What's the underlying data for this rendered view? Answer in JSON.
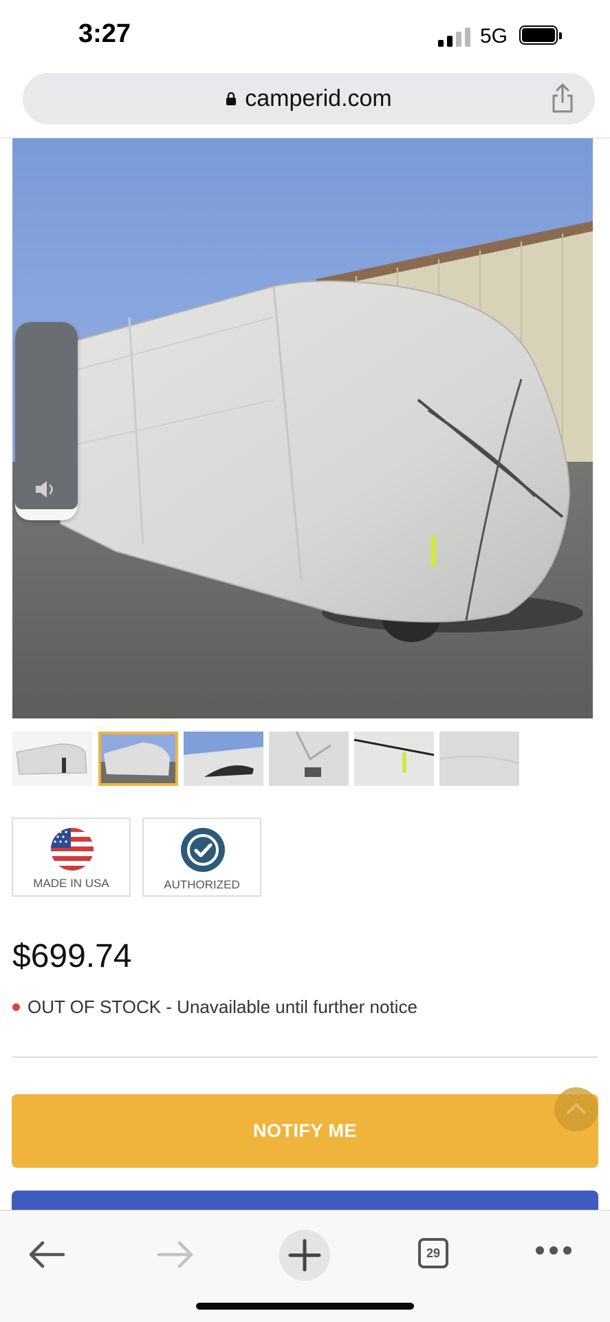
{
  "status_bar": {
    "time": "3:27",
    "network": "5G"
  },
  "browser": {
    "url": "camperid.com"
  },
  "product": {
    "main_image_alt": "RV cover on motorhome",
    "thumbnails": [
      {
        "name": "thumbnail-1",
        "selected": false
      },
      {
        "name": "thumbnail-2",
        "selected": true
      },
      {
        "name": "thumbnail-3",
        "selected": false
      },
      {
        "name": "thumbnail-4",
        "selected": false
      },
      {
        "name": "thumbnail-5",
        "selected": false
      },
      {
        "name": "thumbnail-6",
        "selected": false
      }
    ],
    "badges": {
      "made_in_usa": "MADE IN USA",
      "authorized": "AUTHORIZED"
    },
    "price": "$699.74",
    "stock_status": "OUT OF STOCK - Unavailable until further notice",
    "notify_label": "NOTIFY ME"
  },
  "toolbar": {
    "tab_count": "29"
  },
  "colors": {
    "accent": "#f0b43c",
    "primary_blue": "#3f5bbd",
    "out_of_stock": "#d9453b"
  },
  "icons": [
    "lock-icon",
    "share-icon",
    "speaker-icon",
    "flag-usa-icon",
    "check-badge-icon",
    "chevron-up-icon",
    "back-arrow-icon",
    "forward-arrow-icon",
    "plus-icon",
    "tabs-icon",
    "more-icon"
  ]
}
